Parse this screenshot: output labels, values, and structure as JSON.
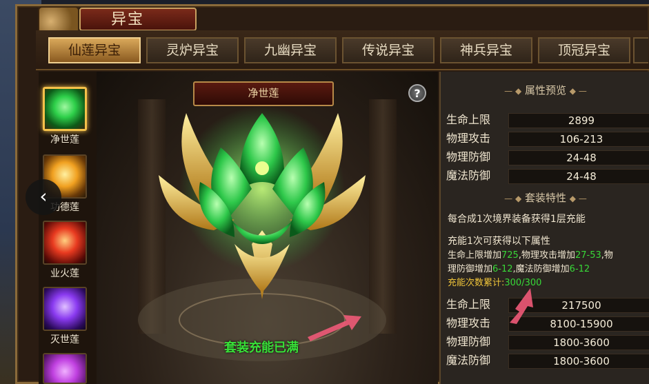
{
  "window": {
    "title": "异宝"
  },
  "tabs": [
    {
      "label": "仙莲异宝",
      "active": true
    },
    {
      "label": "灵炉异宝",
      "active": false
    },
    {
      "label": "九幽异宝",
      "active": false
    },
    {
      "label": "传说异宝",
      "active": false
    },
    {
      "label": "神兵异宝",
      "active": false
    },
    {
      "label": "顶冠异宝",
      "active": false
    }
  ],
  "sidebar": {
    "items": [
      {
        "label": "净世莲",
        "color": "#2ed04a",
        "active": true
      },
      {
        "label": "功德莲",
        "color": "#f0a020",
        "active": false
      },
      {
        "label": "业火莲",
        "color": "#e83a20",
        "active": false
      },
      {
        "label": "灭世莲",
        "color": "#8a3af0",
        "active": false
      },
      {
        "label": "",
        "color": "#c040e0",
        "active": false
      }
    ]
  },
  "stage": {
    "item_name": "净世莲",
    "help_label": "?",
    "status": "套装充能已满"
  },
  "nav": {
    "prev": "‹",
    "next": "›"
  },
  "attributes": {
    "title": "属性预览",
    "rows": [
      {
        "label": "生命上限",
        "value": "2899"
      },
      {
        "label": "物理攻击",
        "value": "106-213"
      },
      {
        "label": "物理防御",
        "value": "24-48"
      },
      {
        "label": "魔法防御",
        "value": "24-48"
      }
    ]
  },
  "set_traits": {
    "title": "套装特性",
    "description": "每合成1次境界装备获得1层充能",
    "charge_intro": "充能1次可获得以下属性",
    "line1_a": "生命上限增加",
    "line1_b": "725",
    "line1_c": ",物理攻击增加",
    "line1_d": "27-53",
    "line1_e": ",物",
    "line2_a": "理防御增加",
    "line2_b": "6-12",
    "line2_c": ",魔法防御增加",
    "line2_d": "6-12",
    "counter_label": "充能次数累计:",
    "counter_value": "300/300",
    "rows": [
      {
        "label": "生命上限",
        "value": "217500"
      },
      {
        "label": "物理攻击",
        "value": "8100-15900"
      },
      {
        "label": "物理防御",
        "value": "1800-3600"
      },
      {
        "label": "魔法防御",
        "value": "1800-3600"
      }
    ]
  },
  "colors": {
    "accent_gold": "#f5c14a",
    "green": "#38d838",
    "arrow": "#f05a78"
  }
}
